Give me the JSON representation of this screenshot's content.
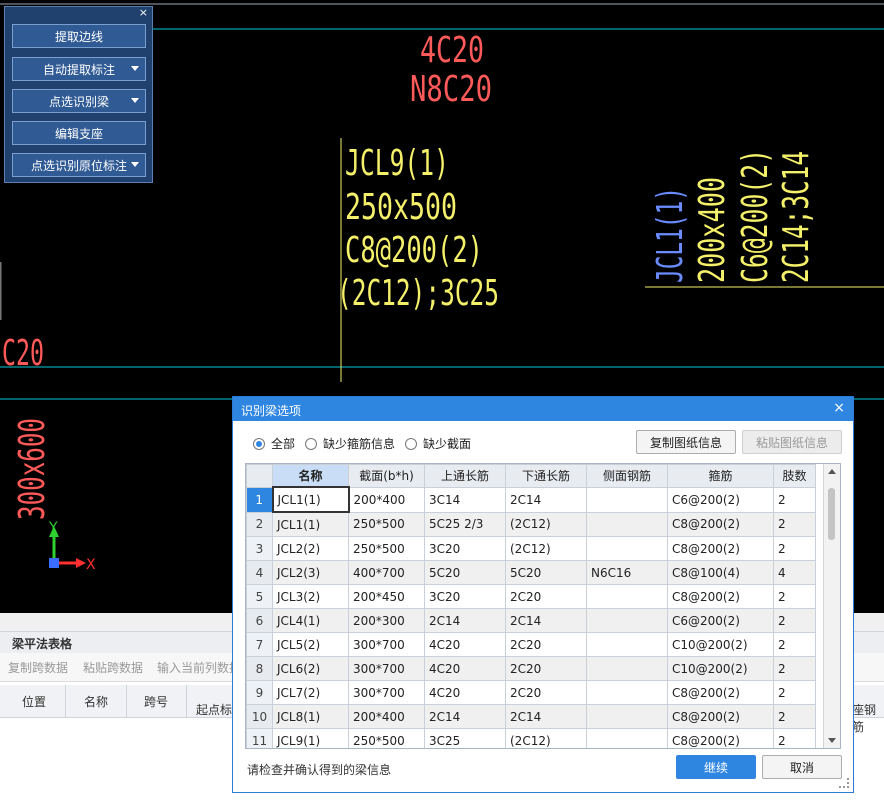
{
  "toolpanel": {
    "close_glyph": "×",
    "buttons": [
      {
        "label": "提取边线",
        "dropdown": false
      },
      {
        "label": "自动提取标注",
        "dropdown": true
      },
      {
        "label": "点选识别梁",
        "dropdown": true
      },
      {
        "label": "编辑支座",
        "dropdown": false
      },
      {
        "label": "点选识别原位标注",
        "dropdown": true
      }
    ]
  },
  "cad": {
    "top_annotation": [
      "4C20",
      "N8C20"
    ],
    "beam_jcl9": [
      "JCL9(1)",
      "250x500",
      "C8@200(2)",
      "(2C12);3C25"
    ],
    "beam_jcl1_vertical": [
      "JCL1(1)",
      "200x400",
      "C6@200(2)",
      "2C14;3C14"
    ],
    "left_fragment": "C20",
    "left_vertical_fragment": "300x600",
    "axis_y": "Y",
    "axis_x": "X",
    "colors": {
      "cyan": "#00c8d8",
      "yellow": "#f5f06a",
      "red": "#ff4a4a",
      "blue": "#6a8cff"
    }
  },
  "bottom_panel": {
    "title": "梁平法表格",
    "toolbar": [
      "复制跨数据",
      "粘贴跨数据",
      "输入当前列数据"
    ],
    "headers": [
      "位置",
      "名称",
      "跨号"
    ],
    "sub_header": "起点标",
    "right_header": "座钢筋"
  },
  "dialog": {
    "title": "识别梁选项",
    "close_glyph": "×",
    "radios": [
      {
        "label": "全部",
        "checked": true
      },
      {
        "label": "缺少箍筋信息",
        "checked": false
      },
      {
        "label": "缺少截面",
        "checked": false
      }
    ],
    "copy_button": "复制图纸信息",
    "paste_button": "粘贴图纸信息",
    "columns": [
      "",
      "名称",
      "截面(b*h)",
      "上通长筋",
      "下通长筋",
      "侧面钢筋",
      "箍筋",
      "肢数"
    ],
    "rows": [
      [
        "1",
        "JCL1(1)",
        "200*400",
        "3C14",
        "2C14",
        "",
        "C6@200(2)",
        "2"
      ],
      [
        "2",
        "JCL1(1)",
        "250*500",
        "5C25 2/3",
        "(2C12)",
        "",
        "C8@200(2)",
        "2"
      ],
      [
        "3",
        "JCL2(2)",
        "250*500",
        "3C20",
        "(2C12)",
        "",
        "C8@200(2)",
        "2"
      ],
      [
        "4",
        "JCL2(3)",
        "400*700",
        "5C20",
        "5C20",
        "N6C16",
        "C8@100(4)",
        "4"
      ],
      [
        "5",
        "JCL3(2)",
        "200*450",
        "3C20",
        "2C20",
        "",
        "C8@200(2)",
        "2"
      ],
      [
        "6",
        "JCL4(1)",
        "200*300",
        "2C14",
        "2C14",
        "",
        "C6@200(2)",
        "2"
      ],
      [
        "7",
        "JCL5(2)",
        "300*700",
        "4C20",
        "2C20",
        "",
        "C10@200(2)",
        "2"
      ],
      [
        "8",
        "JCL6(2)",
        "300*700",
        "4C20",
        "2C20",
        "",
        "C10@200(2)",
        "2"
      ],
      [
        "9",
        "JCL7(2)",
        "300*700",
        "4C20",
        "2C20",
        "",
        "C8@200(2)",
        "2"
      ],
      [
        "10",
        "JCL8(1)",
        "200*400",
        "2C14",
        "2C14",
        "",
        "C8@200(2)",
        "2"
      ],
      [
        "11",
        "JCL9(1)",
        "250*500",
        "3C25",
        "(2C12)",
        "",
        "C8@200(2)",
        "2"
      ]
    ],
    "status": "请检查并确认得到的梁信息",
    "continue_button": "继续",
    "cancel_button": "取消"
  }
}
